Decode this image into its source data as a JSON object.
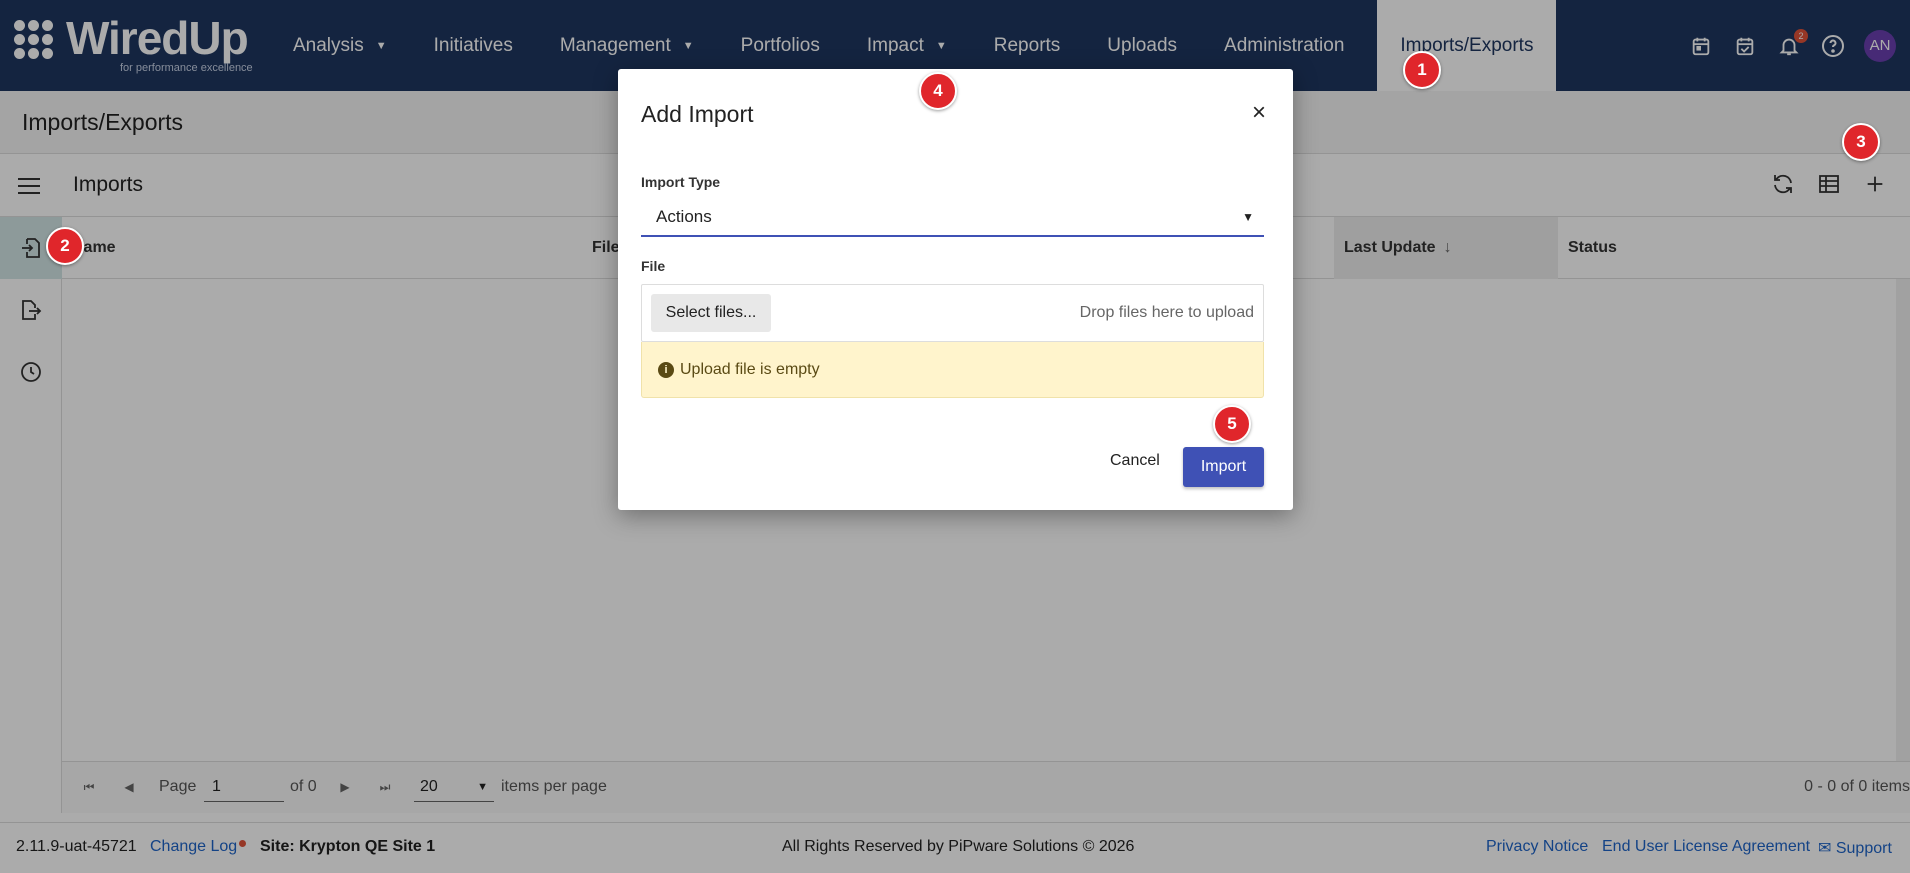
{
  "app": {
    "logo_text": "WiredUp",
    "logo_tagline": "for performance excellence"
  },
  "nav": {
    "items": [
      {
        "label": "Analysis",
        "dropdown": true
      },
      {
        "label": "Initiatives",
        "dropdown": false
      },
      {
        "label": "Management",
        "dropdown": true
      },
      {
        "label": "Portfolios",
        "dropdown": false
      },
      {
        "label": "Impact",
        "dropdown": true
      },
      {
        "label": "Reports",
        "dropdown": false
      },
      {
        "label": "Uploads",
        "dropdown": false
      },
      {
        "label": "Administration",
        "dropdown": false
      },
      {
        "label": "Imports/Exports",
        "dropdown": false,
        "active": true
      }
    ],
    "notification_count": "2",
    "avatar_initials": "AN",
    "icons": [
      "calendar-icon",
      "calendar-check-icon",
      "bell-icon",
      "help-icon"
    ]
  },
  "page": {
    "title": "Imports/Exports"
  },
  "grid": {
    "title": "Imports",
    "columns": [
      "Name",
      "File",
      "Last Update",
      "Status"
    ],
    "sorted_column": "Last Update",
    "sort_direction": "desc",
    "rows": []
  },
  "pager": {
    "page_label": "Page",
    "page_value": "1",
    "of_label": "of 0",
    "page_size": "20",
    "items_per_page_label": "items per page",
    "summary": "0 - 0 of 0 items"
  },
  "footer": {
    "version": "2.11.9-uat-45721",
    "change_log": "Change Log",
    "site": "Site: Krypton QE Site 1",
    "copyright": "All Rights Reserved by PiPware Solutions © 2026",
    "privacy": "Privacy Notice",
    "eula": "End User License Agreement",
    "support": "Support"
  },
  "modal": {
    "title": "Add Import",
    "close": "×",
    "import_type_label": "Import Type",
    "import_type_value": "Actions",
    "file_label": "File",
    "select_files": "Select files...",
    "drop_hint": "Drop files here to upload",
    "warning": "Upload file is empty",
    "cancel": "Cancel",
    "import": "Import"
  },
  "markers": [
    "1",
    "2",
    "3",
    "4",
    "5"
  ],
  "colors": {
    "nav_bg": "#1e3660",
    "primary": "#3f51b5",
    "marker": "#e0262b",
    "warning_bg": "#fff4cc",
    "link": "#1e64c8"
  }
}
